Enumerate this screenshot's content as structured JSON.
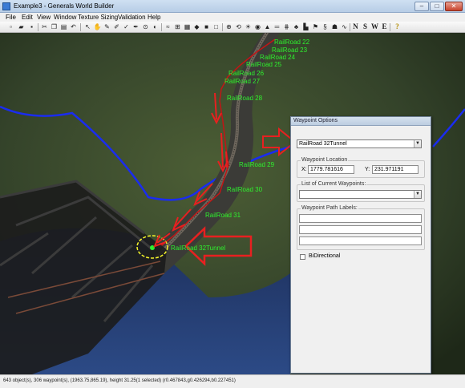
{
  "window": {
    "title": "Example3 - Generals World Builder",
    "minimize": "–",
    "maximize": "□",
    "close": "✕"
  },
  "menu": [
    "File",
    "Edit",
    "View",
    "Window",
    "Texture Sizing",
    "Validation",
    "Help"
  ],
  "toolbar": {
    "compass": [
      "N",
      "S",
      "W",
      "E"
    ],
    "help": "?"
  },
  "viewport": {
    "waypoints": [
      "RailRoad 22",
      "RailRoad 23",
      "RailRoad 24",
      "RailRoad 25",
      "RailRoad 26",
      "RailRoad 27",
      "RailRoad 28",
      "RailRoad 29",
      "RailRoad 30",
      "RailRoad 31",
      "RailRoad 32Tunnel"
    ]
  },
  "dialog": {
    "title": "Waypoint Options",
    "name_value": "RailRoad 32Tunnel",
    "location_label": "Waypoint Location",
    "x_label": "X:",
    "x_value": "1779.781616",
    "y_label": "Y:",
    "y_value": "231.971191",
    "list_label": "List of Current Waypoints:",
    "list_value": "",
    "path_label": "Waypoint Path Labels:",
    "path_labels": [
      "",
      "",
      ""
    ],
    "bidirectional_label": "BiDirectional",
    "bidirectional_checked": false
  },
  "status": {
    "text": "643 object(s), 306 waypoint(s), (1963.75,865.19), height 31.25(1 selected) (r0.467843,g0.426294,b0.227451)"
  },
  "colors": {
    "waypoint_label": "#2ef02e",
    "annotation_arrow": "#e82020",
    "river_line": "#1a2cf0",
    "highlight_circle": "#f5f52a"
  }
}
